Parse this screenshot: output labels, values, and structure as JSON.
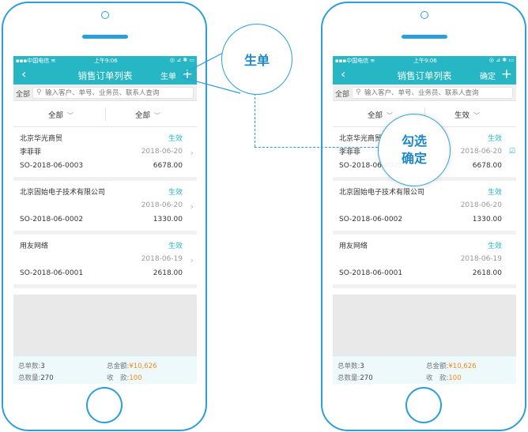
{
  "status_bar": {
    "carrier": "中国电信 ",
    "time": "上午9:06",
    "icons": "◎ ⊿ ✱ ▭"
  },
  "nav": {
    "title": "销售订单列表",
    "left_action": "生单",
    "right_action": "确定"
  },
  "search": {
    "scope": "全部",
    "placeholder": "输入客户、单号、业务员、联系人查询"
  },
  "filters": {
    "left": "全部",
    "right_left_phone": "全部",
    "right_right_phone": "生效"
  },
  "orders": [
    {
      "customer": "北京华光商贸",
      "status": "生效",
      "salesman": "李菲菲",
      "date": "2018-06-20",
      "number": "SO-2018-06-0003",
      "amount": "6678.00"
    },
    {
      "customer": "北京固始电子技术有限公司",
      "status": "生效",
      "salesman": "",
      "date": "2018-06-20",
      "number": "SO-2018-06-0002",
      "amount": "1330.00"
    },
    {
      "customer": "用友网络",
      "status": "生效",
      "salesman": "",
      "date": "2018-06-19",
      "number": "SO-2018-06-0001",
      "amount": "2618.00"
    }
  ],
  "summary": {
    "order_count_label": "总单数:",
    "order_count": "3",
    "amount_label": "总金额:",
    "amount": "¥10,626",
    "qty_label": "总数量:",
    "qty": "270",
    "received_label": "收　款:",
    "received": "100"
  },
  "callouts": {
    "create": "生单",
    "select_line1": "勾选",
    "select_line2": "确定"
  },
  "colors": {
    "primary": "#27b6c3",
    "frame": "#2b9fd9",
    "accent_orange": "#f08a1c"
  }
}
